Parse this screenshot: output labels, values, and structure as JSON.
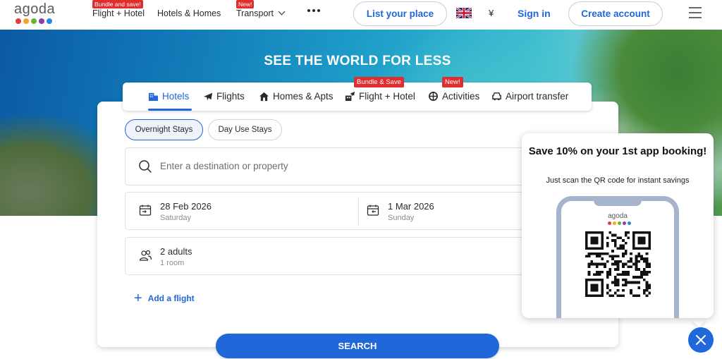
{
  "header": {
    "logo_text": "agoda",
    "logo_colors": [
      "#e23b3b",
      "#f4a52c",
      "#6bb42f",
      "#8e3cae",
      "#2a86e0"
    ],
    "nav": [
      {
        "label": "Flight + Hotel",
        "badge": "Bundle and save!"
      },
      {
        "label": "Hotels & Homes",
        "badge": ""
      },
      {
        "label": "Transport",
        "badge": "New!"
      }
    ],
    "list_your_place": "List your place",
    "currency": "¥",
    "sign_in": "Sign in",
    "create_account": "Create account"
  },
  "hero": {
    "title": "SEE THE WORLD FOR LESS"
  },
  "tabs": [
    {
      "label": "Hotels",
      "badge": "",
      "active": true,
      "icon": "hotel-icon"
    },
    {
      "label": "Flights",
      "badge": "",
      "active": false,
      "icon": "plane-icon"
    },
    {
      "label": "Homes & Apts",
      "badge": "",
      "active": false,
      "icon": "home-icon"
    },
    {
      "label": "Flight + Hotel",
      "badge": "Bundle & Save",
      "active": false,
      "icon": "flight-hotel-icon"
    },
    {
      "label": "Activities",
      "badge": "New!",
      "active": false,
      "icon": "activities-icon"
    },
    {
      "label": "Airport transfer",
      "badge": "",
      "active": false,
      "icon": "car-icon"
    }
  ],
  "search": {
    "stay_types": [
      "Overnight Stays",
      "Day Use Stays"
    ],
    "selected_stay_type": "Overnight Stays",
    "destination_placeholder": "Enter a destination or property",
    "check_in": {
      "date": "28 Feb 2026",
      "day": "Saturday"
    },
    "check_out": {
      "date": "1 Mar 2026",
      "day": "Sunday"
    },
    "occupancy": {
      "guests": "2 adults",
      "rooms": "1 room"
    },
    "add_flight": "Add a flight",
    "search_button": "SEARCH"
  },
  "promo": {
    "title": "Save 10% on your 1st app booking!",
    "subtitle": "Just scan the QR code for instant savings",
    "phone_logo_text": "agoda"
  },
  "colors": {
    "brand_blue": "#2067da",
    "badge_red": "#e12d2d"
  }
}
